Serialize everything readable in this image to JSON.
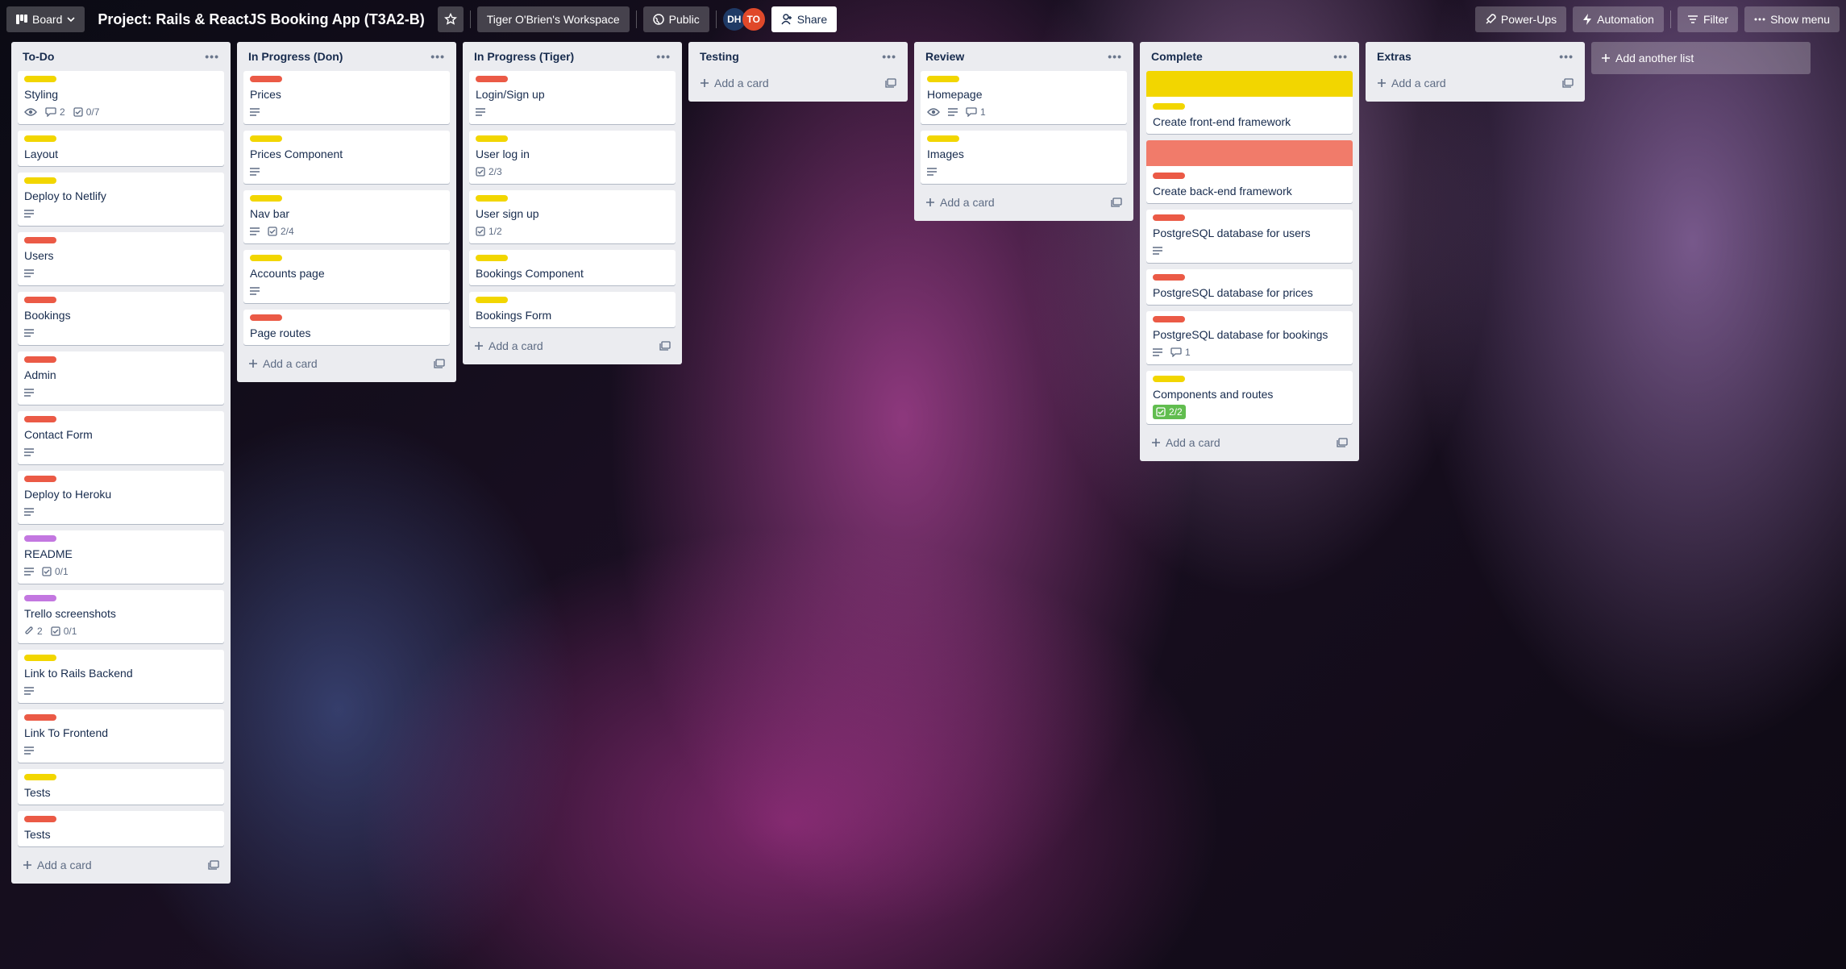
{
  "header": {
    "board_switcher": "Board",
    "title": "Project: Rails & ReactJS Booking App (T3A2-B)",
    "workspace": "Tiger O'Brien's Workspace",
    "visibility": "Public",
    "members": [
      {
        "initials": "DH",
        "color": "#1f3a66"
      },
      {
        "initials": "TO",
        "color": "#e0492a"
      }
    ],
    "share": "Share",
    "power_ups": "Power-Ups",
    "automation": "Automation",
    "filter": "Filter",
    "show_menu": "Show menu"
  },
  "colors": {
    "yellow": "#f2d600",
    "red": "#eb5a46",
    "purple": "#c377e0",
    "green": "#61bd4f",
    "cover_red": "#f17b6a"
  },
  "add_card_label": "Add a card",
  "add_list_label": "Add another list",
  "lists": [
    {
      "title": "To-Do",
      "cards": [
        {
          "title": "Styling",
          "labels": [
            "yellow"
          ],
          "badges": {
            "watch": true,
            "comments": "2",
            "checklist": "0/7"
          }
        },
        {
          "title": "Layout",
          "labels": [
            "yellow"
          ],
          "badges": {}
        },
        {
          "title": "Deploy to Netlify",
          "labels": [
            "yellow"
          ],
          "badges": {
            "description": true
          }
        },
        {
          "title": "Users",
          "labels": [
            "red"
          ],
          "badges": {
            "description": true
          }
        },
        {
          "title": "Bookings",
          "labels": [
            "red"
          ],
          "badges": {
            "description": true
          }
        },
        {
          "title": "Admin",
          "labels": [
            "red"
          ],
          "badges": {
            "description": true
          }
        },
        {
          "title": "Contact Form",
          "labels": [
            "red"
          ],
          "badges": {
            "description": true
          }
        },
        {
          "title": "Deploy to Heroku",
          "labels": [
            "red"
          ],
          "badges": {
            "description": true
          }
        },
        {
          "title": "README",
          "labels": [
            "purple"
          ],
          "badges": {
            "description": true,
            "checklist": "0/1"
          }
        },
        {
          "title": "Trello screenshots",
          "labels": [
            "purple"
          ],
          "badges": {
            "attachments": "2",
            "checklist": "0/1"
          }
        },
        {
          "title": "Link to Rails Backend",
          "labels": [
            "yellow"
          ],
          "badges": {
            "description": true
          }
        },
        {
          "title": "Link To Frontend",
          "labels": [
            "red"
          ],
          "badges": {
            "description": true
          }
        },
        {
          "title": "Tests",
          "labels": [
            "yellow"
          ],
          "badges": {}
        },
        {
          "title": "Tests",
          "labels": [
            "red"
          ],
          "badges": {}
        }
      ]
    },
    {
      "title": "In Progress (Don)",
      "cards": [
        {
          "title": "Prices",
          "labels": [
            "red"
          ],
          "badges": {
            "description": true
          }
        },
        {
          "title": "Prices Component",
          "labels": [
            "yellow"
          ],
          "badges": {
            "description": true
          }
        },
        {
          "title": "Nav bar",
          "labels": [
            "yellow"
          ],
          "badges": {
            "description": true,
            "checklist": "2/4"
          }
        },
        {
          "title": "Accounts page",
          "labels": [
            "yellow"
          ],
          "badges": {
            "description": true
          }
        },
        {
          "title": "Page routes",
          "labels": [
            "red"
          ],
          "badges": {}
        }
      ]
    },
    {
      "title": "In Progress (Tiger)",
      "cards": [
        {
          "title": "Login/Sign up",
          "labels": [
            "red"
          ],
          "badges": {
            "description": true
          }
        },
        {
          "title": "User log in",
          "labels": [
            "yellow"
          ],
          "badges": {
            "checklist": "2/3"
          }
        },
        {
          "title": "User sign up",
          "labels": [
            "yellow"
          ],
          "badges": {
            "checklist": "1/2"
          }
        },
        {
          "title": "Bookings Component",
          "labels": [
            "yellow"
          ],
          "badges": {}
        },
        {
          "title": "Bookings Form",
          "labels": [
            "yellow"
          ],
          "badges": {}
        }
      ]
    },
    {
      "title": "Testing",
      "cards": []
    },
    {
      "title": "Review",
      "cards": [
        {
          "title": "Homepage",
          "labels": [
            "yellow"
          ],
          "badges": {
            "watch": true,
            "description": true,
            "comments": "1"
          }
        },
        {
          "title": "Images",
          "labels": [
            "yellow"
          ],
          "badges": {
            "description": true
          }
        }
      ]
    },
    {
      "title": "Complete",
      "cards": [
        {
          "title": "Create front-end framework",
          "cover": "yellow",
          "labels": [
            "yellow"
          ],
          "badges": {}
        },
        {
          "title": "Create back-end framework",
          "cover": "cover_red",
          "labels": [
            "red"
          ],
          "badges": {}
        },
        {
          "title": "PostgreSQL database for users",
          "labels": [
            "red"
          ],
          "badges": {
            "description": true
          }
        },
        {
          "title": "PostgreSQL database for prices",
          "labels": [
            "red"
          ],
          "badges": {}
        },
        {
          "title": "PostgreSQL database for bookings",
          "labels": [
            "red"
          ],
          "badges": {
            "description": true,
            "comments": "1"
          }
        },
        {
          "title": "Components and routes",
          "labels": [
            "yellow"
          ],
          "badges": {
            "checklist_done": "2/2"
          }
        }
      ]
    },
    {
      "title": "Extras",
      "cards": []
    }
  ]
}
